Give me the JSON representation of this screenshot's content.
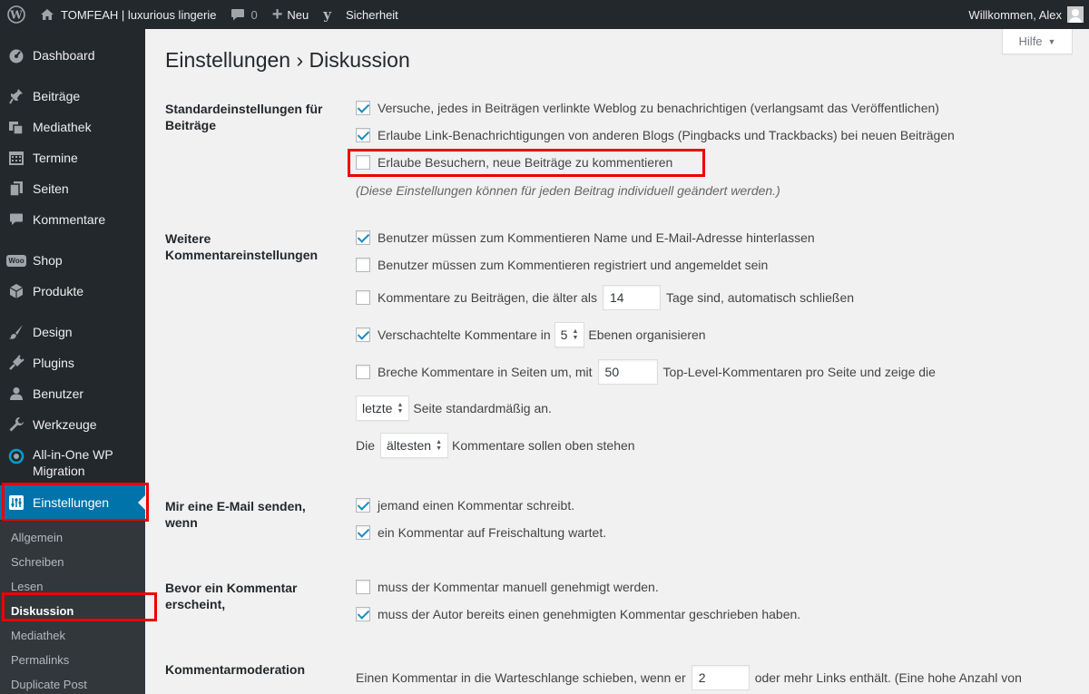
{
  "adminbar": {
    "site_name": "TOMFEAH | luxurious lingerie",
    "comments_count": "0",
    "new_label": "Neu",
    "security_label": "Sicherheit",
    "welcome": "Willkommen, Alex"
  },
  "help": {
    "label": "Hilfe"
  },
  "sidebar": {
    "items": [
      {
        "label": "Dashboard",
        "icon": "dashboard-icon"
      },
      {
        "label": "Beiträge",
        "icon": "pin-icon"
      },
      {
        "label": "Mediathek",
        "icon": "media-icon"
      },
      {
        "label": "Termine",
        "icon": "calendar-icon"
      },
      {
        "label": "Seiten",
        "icon": "pages-icon"
      },
      {
        "label": "Kommentare",
        "icon": "comment-icon"
      },
      {
        "label": "Shop",
        "icon": "woo-icon"
      },
      {
        "label": "Produkte",
        "icon": "box-icon"
      },
      {
        "label": "Design",
        "icon": "brush-icon"
      },
      {
        "label": "Plugins",
        "icon": "plug-icon"
      },
      {
        "label": "Benutzer",
        "icon": "user-icon"
      },
      {
        "label": "Werkzeuge",
        "icon": "wrench-icon"
      },
      {
        "label": "All-in-One WP",
        "label2": "Migration",
        "icon": "migration-icon"
      },
      {
        "label": "Einstellungen",
        "icon": "settings-icon"
      }
    ],
    "submenu": [
      "Allgemein",
      "Schreiben",
      "Lesen",
      "Diskussion",
      "Mediathek",
      "Permalinks",
      "Duplicate Post"
    ]
  },
  "page": {
    "title": "Einstellungen › Diskussion"
  },
  "sections": {
    "defaults": {
      "title": "Standardeinstellungen für Beiträge",
      "opt1": "Versuche, jedes in Beiträgen verlinkte Weblog zu benachrichtigen (verlangsamt das Veröffentlichen)",
      "opt2": "Erlaube Link-Benachrichtigungen von anderen Blogs (Pingbacks und Trackbacks) bei neuen Beiträgen",
      "opt3": "Erlaube Besuchern, neue Beiträge zu kommentieren",
      "note": "(Diese Einstellungen können für jeden Beitrag individuell geändert werden.)"
    },
    "other": {
      "title": "Weitere Kommentareinstellungen",
      "opt1": "Benutzer müssen zum Kommentieren Name und E-Mail-Adresse hinterlassen",
      "opt2": "Benutzer müssen zum Kommentieren registriert und angemeldet sein",
      "close_pre": "Kommentare zu Beiträgen, die älter als",
      "close_days": "14",
      "close_post": "Tage sind, automatisch schließen",
      "thread_pre": "Verschachtelte Kommentare in",
      "thread_levels": "5",
      "thread_post": "Ebenen organisieren",
      "page_pre": "Breche Kommentare in Seiten um, mit",
      "page_count": "50",
      "page_post": "Top-Level-Kommentaren pro Seite und zeige die",
      "page_which": "letzte",
      "page_end": "Seite standardmäßig an.",
      "order_pre": "Die",
      "order_value": "ältesten",
      "order_post": "Kommentare sollen oben stehen"
    },
    "email": {
      "title": "Mir eine E-Mail senden, wenn",
      "opt1": "jemand einen Kommentar schreibt.",
      "opt2": "ein Kommentar auf Freischaltung wartet."
    },
    "before": {
      "title": "Bevor ein Kommentar erscheint,",
      "opt1": "muss der Kommentar manuell genehmigt werden.",
      "opt2": "muss der Autor bereits einen genehmigten Kommentar geschrieben haben."
    },
    "moderation": {
      "title": "Kommentarmoderation",
      "pre": "Einen Kommentar in die Warteschlange schieben, wenn er",
      "links": "2",
      "post": "oder mehr Links enthält. (Eine hohe Anzahl von"
    }
  },
  "checkbox_states": {
    "defaults": [
      true,
      true,
      false
    ],
    "other": [
      true,
      false,
      false,
      true,
      false
    ],
    "email": [
      true,
      true
    ],
    "before": [
      false,
      true
    ]
  },
  "colors": {
    "adminbar": "#23282d",
    "current_menu": "#0073aa",
    "highlight": "#e00000"
  }
}
